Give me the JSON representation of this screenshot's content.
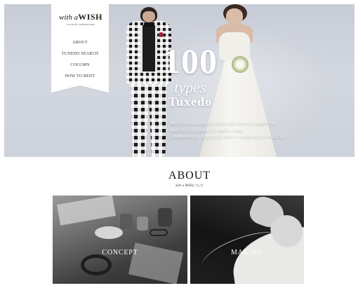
{
  "logo": {
    "main_script": "with a",
    "main_bold": "WISH",
    "sub": "TUXEDO WARDROBE"
  },
  "nav": {
    "items": [
      {
        "label": "ABOUT"
      },
      {
        "label": "TUXEDO SEARCH"
      },
      {
        "label": "COLUMN"
      },
      {
        "label": "HOW TO RENT"
      }
    ]
  },
  "hero": {
    "number": "100",
    "types": "types",
    "tuxedo": "Tuxedo",
    "lead_lines": [
      "普段なら自分には似合わないのではと思うスタイルにも挑戦できる",
      "特別な日だからこそ出会える一着がきっとある",
      "100種類の中から、あなたに似合うタキシードを見つけるアイテムになる"
    ]
  },
  "about": {
    "title": "ABOUT",
    "subtitle": "with a WISHについて"
  },
  "cards": [
    {
      "label": "CONCEPT"
    },
    {
      "label": "MAKING"
    }
  ]
}
